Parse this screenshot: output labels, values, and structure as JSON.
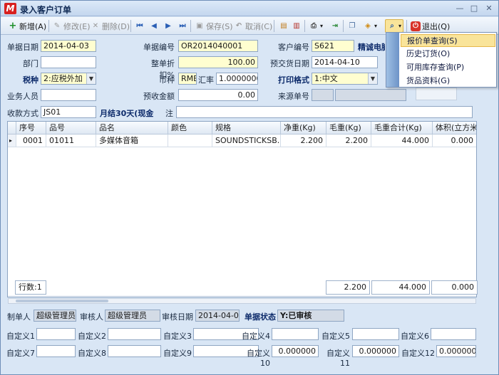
{
  "window": {
    "title": "录入客户订单",
    "logo": "M"
  },
  "toolbar": {
    "add": "新增(A)",
    "edit": "修改(E)",
    "delete": "删除(D)",
    "save": "保存(S)",
    "cancel": "取消(C)",
    "exit": "退出(Q)"
  },
  "dropdown": {
    "items": [
      "报价单查询(S)",
      "历史订货(O)",
      "可用库存查询(P)",
      "货品资料(G)"
    ]
  },
  "header": {
    "doc_date_label": "单据日期",
    "doc_date": "2014-04-03",
    "doc_no_label": "单据编号",
    "doc_no": "OR2014040001",
    "customer_no_label": "客户编号",
    "customer_no": "S621",
    "customer_name": "精诚电脑",
    "dept_label": "部门",
    "dept": "",
    "discount_label": "整单折扣%",
    "discount": "100.00",
    "delivery_label": "预交货日期",
    "delivery_date": "2014-04-10",
    "tax_label": "税种",
    "tax": "2:应税外加",
    "currency_label": "币种",
    "currency": "RMB",
    "rate_label": "汇率",
    "rate": "1.0000000",
    "print_label": "打印格式",
    "print": "1:中文",
    "staff_label": "业务人员",
    "staff": "",
    "prepay_label": "预收金额",
    "prepay": "0.00",
    "source_label": "来源单号",
    "source": "",
    "payment_label": "收款方式",
    "payment": "JS01",
    "payment_desc": "月结30天(现金",
    "note_label": "注",
    "note": ""
  },
  "grid": {
    "columns": [
      "序号",
      "品号",
      "品名",
      "颜色",
      "规格",
      "净重(Kg)",
      "毛重(Kg)",
      "毛重合计(Kg)",
      "体积(立方米"
    ],
    "rows": [
      {
        "marker": "▸",
        "seq": "0001",
        "code": "01011",
        "name": "多媒体音箱",
        "color": "",
        "spec": "SOUNDSTICKSB...",
        "net": "2.200",
        "gross": "2.200",
        "gross_total": "44.000",
        "volume": "0.000"
      }
    ],
    "footer": {
      "rows_label": "行数:1",
      "gross": "2.200",
      "gross_total": "44.000",
      "volume": "0.000"
    }
  },
  "bottom": {
    "maker_label": "制单人",
    "maker": "超级管理员",
    "auditor_label": "审核人",
    "auditor": "超级管理员",
    "audit_date_label": "审核日期",
    "audit_date": "2014-04-03",
    "status_label": "单据状态",
    "status": "Y:已审核",
    "custom": [
      {
        "label": "自定义1",
        "value": ""
      },
      {
        "label": "自定义2",
        "value": ""
      },
      {
        "label": "自定义3",
        "value": ""
      },
      {
        "label": "自定义4",
        "value": ""
      },
      {
        "label": "自定义5",
        "value": ""
      },
      {
        "label": "自定义6",
        "value": ""
      },
      {
        "label": "自定义7",
        "value": ""
      },
      {
        "label": "自定义8",
        "value": ""
      },
      {
        "label": "自定义9",
        "value": ""
      },
      {
        "label": "自定义10",
        "value": "0.000000"
      },
      {
        "label": "自定义11",
        "value": "0.000000"
      },
      {
        "label": "自定义12",
        "value": "0.000000"
      }
    ]
  }
}
